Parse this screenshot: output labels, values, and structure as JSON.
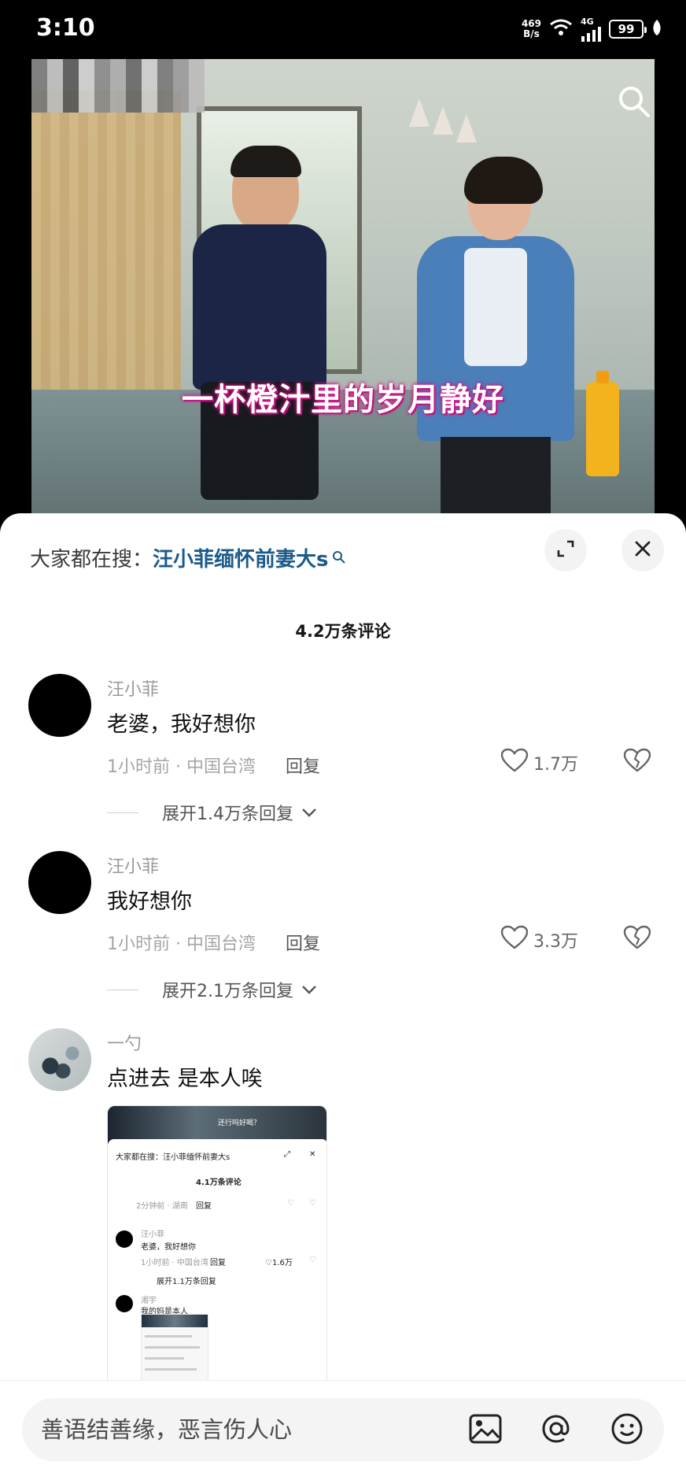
{
  "status_bar": {
    "time": "3:10",
    "net_speed_value": "469",
    "net_speed_unit": "B/s",
    "network": "4G",
    "battery": "99"
  },
  "video": {
    "caption": "一杯橙汁里的岁月静好"
  },
  "hot_search": {
    "prefix": "大家都在搜：",
    "term": "汪小菲缅怀前妻大s"
  },
  "comments_header": {
    "count_label": "4.2万条评论"
  },
  "comments": [
    {
      "user": "汪小菲",
      "text": "老婆，我好想你",
      "time_location": "1小时前 · 中国台湾",
      "reply_label": "回复",
      "likes": "1.7万",
      "expand_label": "展开1.4万条回复"
    },
    {
      "user": "汪小菲",
      "text": "我好想你",
      "time_location": "1小时前 · 中国台湾",
      "reply_label": "回复",
      "likes": "3.3万",
      "expand_label": "展开2.1万条回复"
    },
    {
      "user": "一勺",
      "text": "点进去 是本人唉"
    }
  ],
  "embedded_screenshot": {
    "video_caption": "还行吗好喝？",
    "hot_search": "大家都在搜：汪小菲缅怀前妻大s",
    "count_label": "4.1万条评论",
    "top_meta": "2分钟前 · 湖南",
    "top_reply": "回复",
    "comment_user": "汪小菲",
    "comment_text": "老婆，我好想你",
    "comment_meta": "1小时前 · 中国台湾",
    "comment_reply": "回复",
    "comment_likes": "1.6万",
    "expand_label": "展开1.1万条回复",
    "second_user": "湘宇",
    "second_text": "我的妈是本人"
  },
  "input_bar": {
    "placeholder": "善语结善缘，恶言伤人心"
  },
  "colors": {
    "hot_search_term": "#1c5a8a",
    "caption_glow": "#d2148a",
    "battery": "#ffffff"
  },
  "icons": [
    "search-icon",
    "expand-icon",
    "close-icon",
    "heart-icon",
    "broken-heart-icon",
    "chevron-down-icon",
    "image-icon",
    "at-icon",
    "emoji-icon",
    "wifi-icon",
    "signal-icon",
    "leaf-icon"
  ]
}
